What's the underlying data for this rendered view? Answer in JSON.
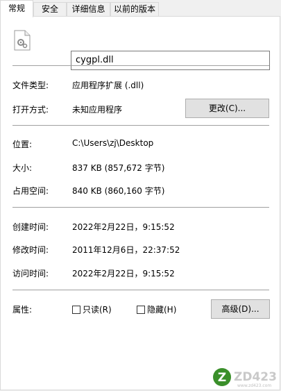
{
  "tabs": [
    "常规",
    "安全",
    "详细信息",
    "以前的版本"
  ],
  "file": {
    "name": "cygpl.dll",
    "icon": "dll-file-icon"
  },
  "rows": {
    "type": {
      "label": "文件类型:",
      "value": "应用程序扩展 (.dll)"
    },
    "open": {
      "label": "打开方式:",
      "value": "未知应用程序",
      "button": "更改(C)..."
    },
    "location": {
      "label": "位置:",
      "value": "C:\\Users\\zj\\Desktop"
    },
    "size": {
      "label": "大小:",
      "value": "837 KB (857,672 字节)"
    },
    "disk": {
      "label": "占用空间:",
      "value": "840 KB (860,160 字节)"
    },
    "created": {
      "label": "创建时间:",
      "value": "2022年2月22日，9:15:52"
    },
    "modified": {
      "label": "修改时间:",
      "value": "2011年12月6日，22:37:52"
    },
    "accessed": {
      "label": "访问时间:",
      "value": "2022年2月22日，9:15:52"
    }
  },
  "attributes": {
    "label": "属性:",
    "readonly": {
      "label": "只读(R)",
      "checked": false
    },
    "hidden": {
      "label": "隐藏(H)",
      "checked": false
    },
    "advanced_button": "高级(D)..."
  },
  "watermark": {
    "text": "ZD423",
    "letter": "Z",
    "url": "www.zd423.com"
  }
}
